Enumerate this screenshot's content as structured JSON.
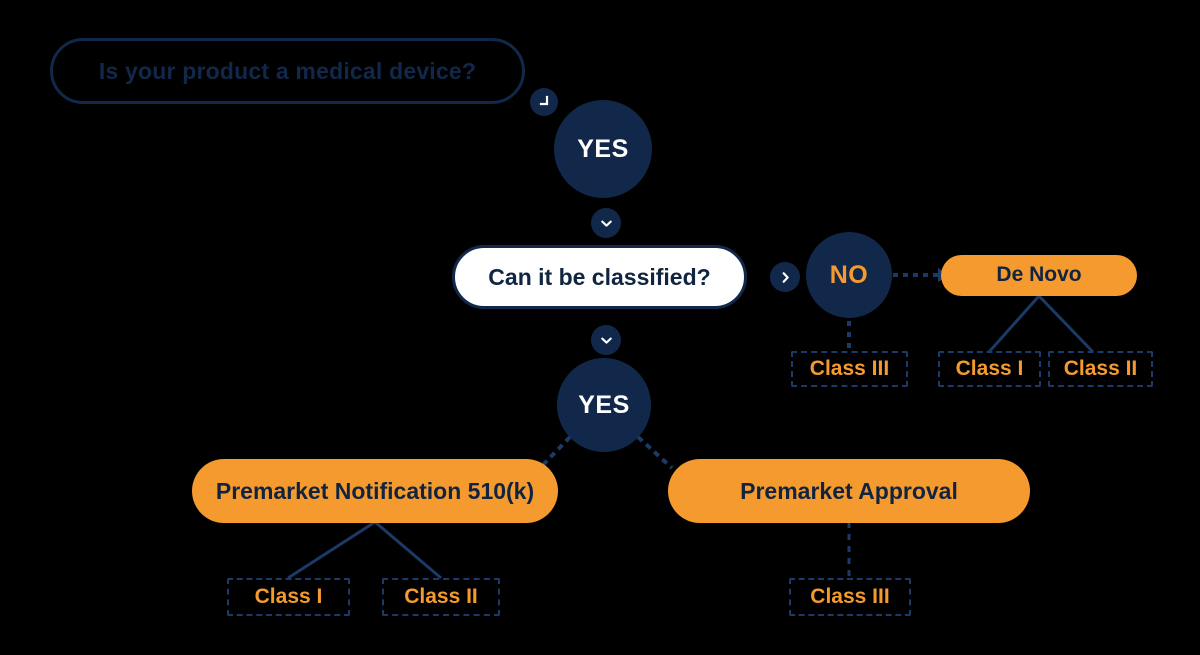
{
  "diagram": {
    "title_text": "Is your product a medical device?",
    "background_color": "#000000",
    "navy": "#12284a",
    "orange": "#f59a2e",
    "white": "#ffffff"
  },
  "nodes": {
    "q1": {
      "label": "Is your product a medical device?"
    },
    "yes1": {
      "label": "YES"
    },
    "q2": {
      "label": "Can it be classified?"
    },
    "no1": {
      "label": "NO"
    },
    "de_novo": {
      "label": "De Novo"
    },
    "yes2": {
      "label": "YES"
    },
    "pmn510k": {
      "label": "Premarket Notification 510(k)"
    },
    "pma": {
      "label": "Premarket Approval"
    }
  },
  "chips": {
    "no_class3": {
      "label": "Class III"
    },
    "denovo_class1": {
      "label": "Class I"
    },
    "denovo_class2": {
      "label": "Class II"
    },
    "k510_class1": {
      "label": "Class I"
    },
    "k510_class2": {
      "label": "Class II"
    },
    "pma_class3": {
      "label": "Class III"
    }
  },
  "icons": {
    "elbow": "corner-down-left-icon",
    "chevron_down_1": "chevron-down-icon",
    "chevron_down_2": "chevron-down-icon",
    "chevron_right": "chevron-right-icon"
  }
}
